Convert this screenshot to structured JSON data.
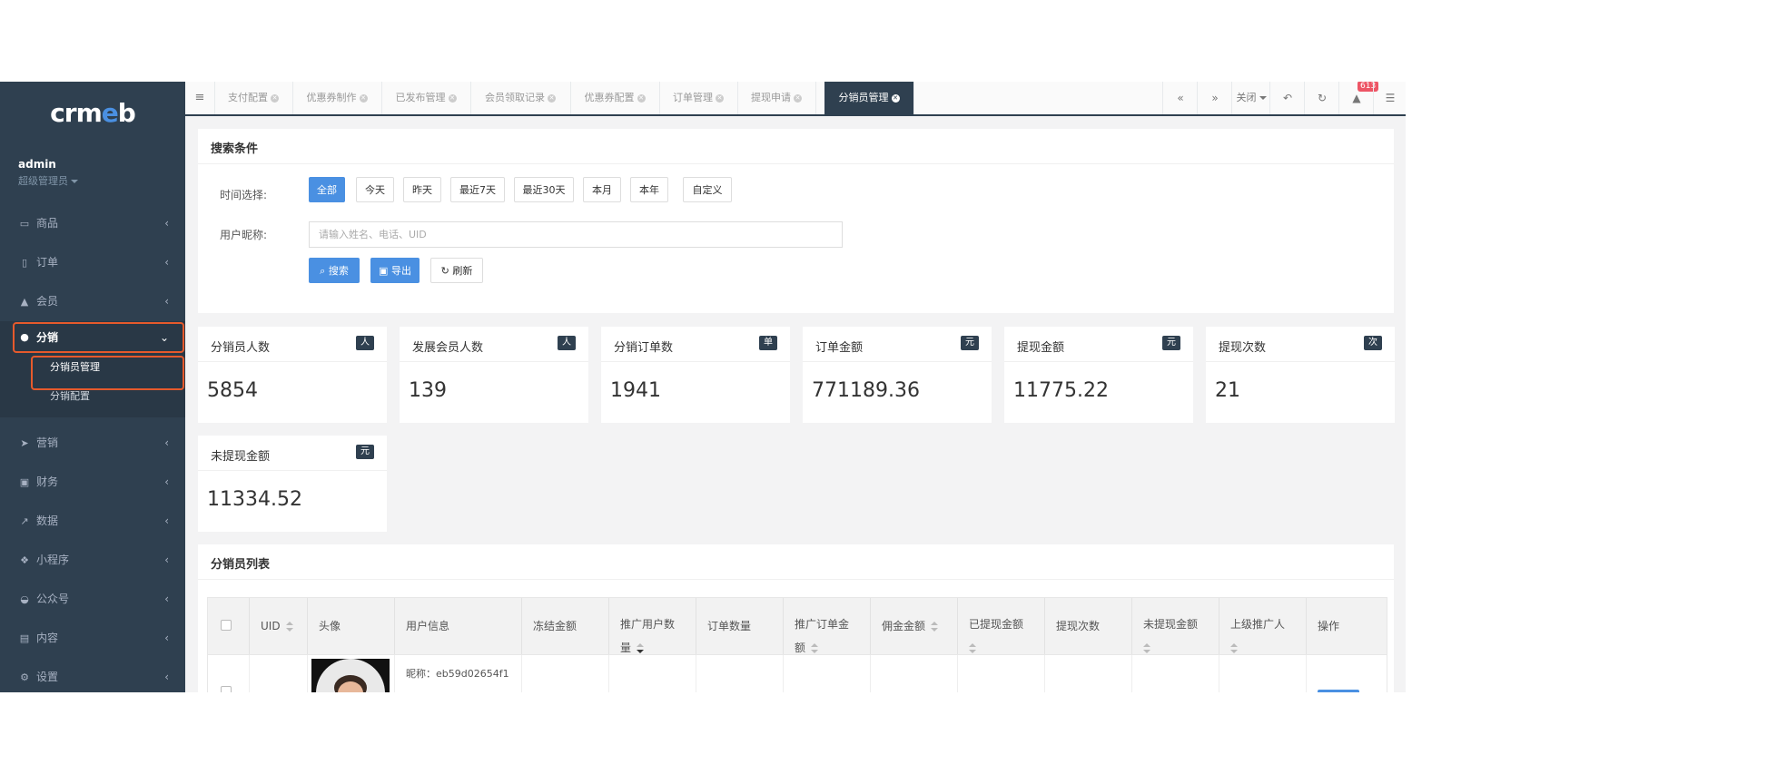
{
  "brand": {
    "logo_prefix": "crm",
    "logo_e": "e",
    "logo_suffix": "b"
  },
  "user": {
    "name": "admin",
    "role": "超级管理员"
  },
  "sidebar": {
    "items": [
      {
        "label": "商品",
        "icon": "laptop-icon"
      },
      {
        "label": "订单",
        "icon": "receipt-icon"
      },
      {
        "label": "会员",
        "icon": "user-icon"
      },
      {
        "label": "分销",
        "icon": "users-icon",
        "expanded": true
      },
      {
        "label": "营销",
        "icon": "paper-plane-icon"
      },
      {
        "label": "财务",
        "icon": "money-icon"
      },
      {
        "label": "数据",
        "icon": "line-chart-icon"
      },
      {
        "label": "小程序",
        "icon": "cubes-icon"
      },
      {
        "label": "公众号",
        "icon": "wechat-icon"
      },
      {
        "label": "内容",
        "icon": "book-icon"
      },
      {
        "label": "设置",
        "icon": "gear-icon"
      }
    ],
    "sub_items": [
      {
        "label": "分销员管理",
        "active": true
      },
      {
        "label": "分销配置"
      }
    ],
    "highlight_color": "#e65a2c"
  },
  "tabs": [
    {
      "label": "支付配置"
    },
    {
      "label": "优惠券制作"
    },
    {
      "label": "已发布管理"
    },
    {
      "label": "会员领取记录"
    },
    {
      "label": "优惠券配置"
    },
    {
      "label": "订单管理"
    },
    {
      "label": "提现申请"
    },
    {
      "label": "分销员管理",
      "active": true
    }
  ],
  "toolbar": {
    "close_label": "关闭",
    "notification_count": "613"
  },
  "search": {
    "title": "搜索条件",
    "time_label": "时间选择:",
    "time_options": [
      "全部",
      "今天",
      "昨天",
      "最近7天",
      "最近30天",
      "本月",
      "本年",
      "自定义"
    ],
    "time_selected": "全部",
    "nickname_label": "用户昵称:",
    "nickname_placeholder": "请输入姓名、电话、UID",
    "search_button": "搜索",
    "export_button": "导出",
    "refresh_button": "刷新"
  },
  "stats": [
    {
      "title": "分销员人数",
      "badge": "人",
      "value": "5854"
    },
    {
      "title": "发展会员人数",
      "badge": "人",
      "value": "139"
    },
    {
      "title": "分销订单数",
      "badge": "单",
      "value": "1941"
    },
    {
      "title": "订单金额",
      "badge": "元",
      "value": "771189.36"
    },
    {
      "title": "提现金额",
      "badge": "元",
      "value": "11775.22"
    },
    {
      "title": "提现次数",
      "badge": "次",
      "value": "21"
    },
    {
      "title": "未提现金额",
      "badge": "元",
      "value": "11334.52"
    }
  ],
  "list": {
    "title": "分销员列表",
    "columns": [
      {
        "line1": "UID",
        "line2": ""
      },
      {
        "line1": "头像",
        "line2": ""
      },
      {
        "line1": "用户信息",
        "line2": ""
      },
      {
        "line1": "冻结金额",
        "line2": ""
      },
      {
        "line1": "推广用户数",
        "line2": "量"
      },
      {
        "line1": "订单数量",
        "line2": ""
      },
      {
        "line1": "推广订单金",
        "line2": "额"
      },
      {
        "line1": "佣金金额",
        "line2": ""
      },
      {
        "line1": "已提现金额",
        "line2": ""
      },
      {
        "line1": "提现次数",
        "line2": ""
      },
      {
        "line1": "未提现金额",
        "line2": ""
      },
      {
        "line1": "上级推广人",
        "line2": ""
      },
      {
        "line1": "操作",
        "line2": ""
      }
    ],
    "rows": [
      {
        "nickname": "昵称：eb59d02654f1"
      }
    ]
  },
  "colors": {
    "sidebar_bg": "#2f4050",
    "primary": "#4a90e2",
    "badge_red": "#ed5565"
  }
}
